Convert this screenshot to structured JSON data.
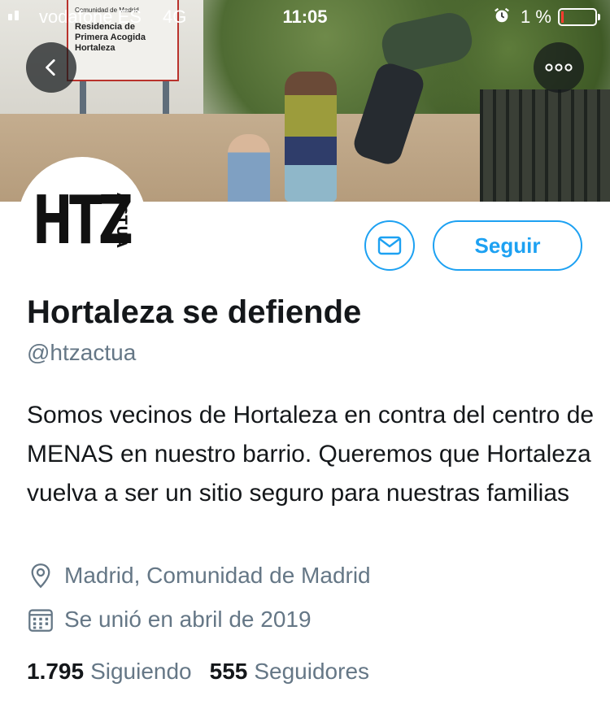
{
  "status_bar": {
    "carrier": "vodafone ES",
    "network": "4G",
    "time": "11:05",
    "battery_percent": "1 %",
    "battery_level": 0.01,
    "icons": [
      "signal-icon",
      "alarm-icon",
      "battery-icon"
    ]
  },
  "banner": {
    "sign_lines": [
      "Comunidad de Madrid",
      "Residencia de",
      "Primera Acogida",
      "Hortaleza"
    ]
  },
  "profile": {
    "avatar_logo_main": "HTZ",
    "avatar_logo_sub": "ACTUA",
    "name": "Hortaleza se defiende",
    "handle": "@htzactua",
    "bio": "Somos vecinos de Hortaleza en contra del centro de MENAS en nuestro barrio. Queremos que Hortaleza vuelva a ser un sitio seguro para nuestras familias",
    "location": "Madrid, Comunidad de Madrid",
    "joined": "Se unió en abril de 2019"
  },
  "actions": {
    "follow_label": "Seguir",
    "message_icon": "envelope-icon",
    "back_icon": "chevron-left-icon",
    "more_icon": "more-dots-icon"
  },
  "stats": {
    "following_count": "1.795",
    "following_label": "Siguiendo",
    "followers_count": "555",
    "followers_label": "Seguidores"
  },
  "colors": {
    "accent": "#1da1f2",
    "secondary_text": "#657786",
    "primary_text": "#14171a",
    "battery_low": "#ff3b30"
  }
}
